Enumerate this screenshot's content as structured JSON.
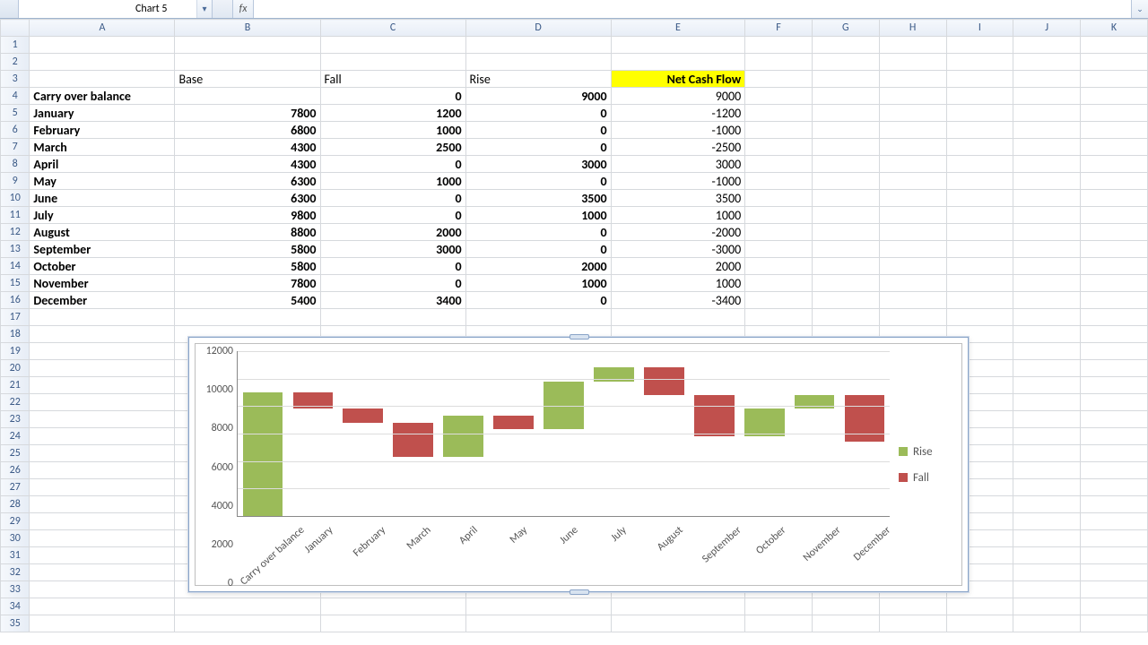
{
  "namebox": {
    "value": "Chart 5",
    "fx_label": "fx"
  },
  "columns": [
    "A",
    "B",
    "C",
    "D",
    "E",
    "F",
    "G",
    "H",
    "I",
    "J",
    "K"
  ],
  "visible_rows": 35,
  "headers": {
    "B3": "Base",
    "C3": "Fall",
    "D3": "Rise",
    "E3": "Net Cash Flow"
  },
  "table": {
    "rows": [
      {
        "label": "Carry over balance",
        "base": "",
        "fall": 0,
        "rise": 9000,
        "net": 9000
      },
      {
        "label": "January",
        "base": 7800,
        "fall": 1200,
        "rise": 0,
        "net": -1200
      },
      {
        "label": "February",
        "base": 6800,
        "fall": 1000,
        "rise": 0,
        "net": -1000
      },
      {
        "label": "March",
        "base": 4300,
        "fall": 2500,
        "rise": 0,
        "net": -2500
      },
      {
        "label": "April",
        "base": 4300,
        "fall": 0,
        "rise": 3000,
        "net": 3000
      },
      {
        "label": "May",
        "base": 6300,
        "fall": 1000,
        "rise": 0,
        "net": -1000
      },
      {
        "label": "June",
        "base": 6300,
        "fall": 0,
        "rise": 3500,
        "net": 3500
      },
      {
        "label": "July",
        "base": 9800,
        "fall": 0,
        "rise": 1000,
        "net": 1000
      },
      {
        "label": "August",
        "base": 8800,
        "fall": 2000,
        "rise": 0,
        "net": -2000
      },
      {
        "label": "September",
        "base": 5800,
        "fall": 3000,
        "rise": 0,
        "net": -3000
      },
      {
        "label": "October",
        "base": 5800,
        "fall": 0,
        "rise": 2000,
        "net": 2000
      },
      {
        "label": "November",
        "base": 7800,
        "fall": 0,
        "rise": 1000,
        "net": 1000
      },
      {
        "label": "December",
        "base": 5400,
        "fall": 3400,
        "rise": 0,
        "net": -3400
      }
    ]
  },
  "legend": {
    "rise": "Rise",
    "fall": "Fall"
  },
  "chart_data": {
    "type": "bar",
    "stacked": true,
    "categories": [
      "Carry over balance",
      "January",
      "February",
      "March",
      "April",
      "May",
      "June",
      "July",
      "August",
      "September",
      "October",
      "November",
      "December"
    ],
    "series": [
      {
        "name": "Base",
        "values": [
          0,
          7800,
          6800,
          4300,
          4300,
          6300,
          6300,
          9800,
          8800,
          5800,
          5800,
          7800,
          5400
        ],
        "invisible": true
      },
      {
        "name": "Fall",
        "values": [
          0,
          1200,
          1000,
          2500,
          0,
          1000,
          0,
          0,
          2000,
          3000,
          0,
          0,
          3400
        ],
        "color": "#c0504d"
      },
      {
        "name": "Rise",
        "values": [
          9000,
          0,
          0,
          0,
          3000,
          0,
          3500,
          1000,
          0,
          0,
          2000,
          1000,
          0
        ],
        "color": "#9bbb59"
      }
    ],
    "ylim": [
      0,
      12000
    ],
    "yticks": [
      0,
      2000,
      4000,
      6000,
      8000,
      10000,
      12000
    ],
    "xlabel": "",
    "ylabel": "",
    "title": ""
  }
}
